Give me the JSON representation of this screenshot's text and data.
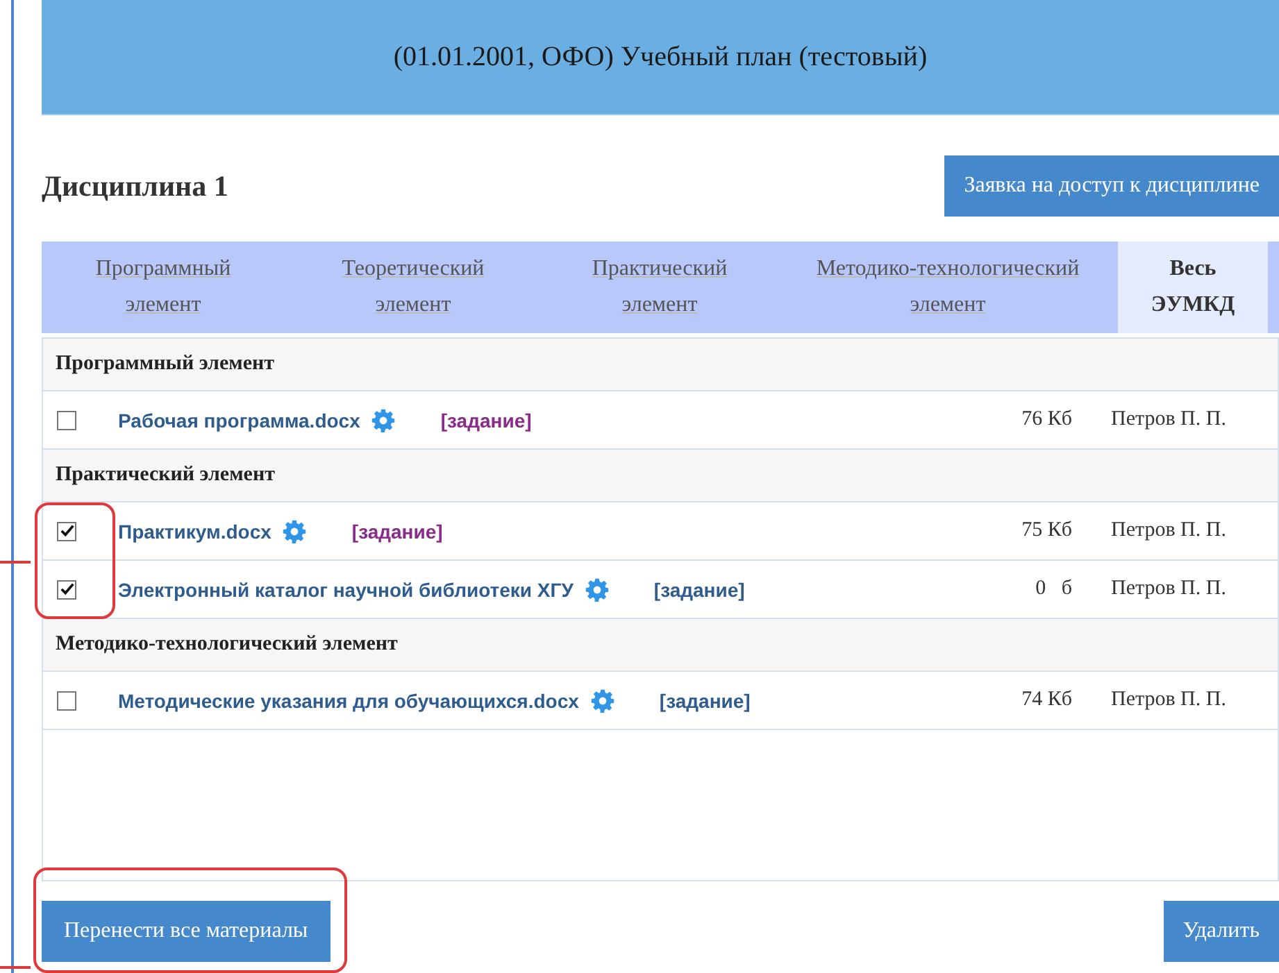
{
  "header": {
    "title": "(01.01.2001, ОФО) Учебный план (тестовый)"
  },
  "discipline": {
    "title": "Дисциплина 1",
    "request_button": "Заявка на доступ к дисциплине"
  },
  "tabs": [
    {
      "label": "Программный элемент",
      "selected": false
    },
    {
      "label": "Теоретический элемент",
      "selected": false
    },
    {
      "label": "Практический элемент",
      "selected": false
    },
    {
      "label": "Методико-технологический элемент",
      "selected": false
    },
    {
      "label": "Весь ЭУМКД",
      "selected": true
    }
  ],
  "groups": [
    {
      "title": "Программный элемент",
      "items": [
        {
          "name": "Рабочая программа.docx",
          "task": "[задание]",
          "visited": true,
          "size": "76 Кб",
          "author": "Петров П. П.",
          "checked": false,
          "highlighted": false
        }
      ]
    },
    {
      "title": "Практический элемент",
      "items": [
        {
          "name": "Практикум.docx",
          "task": "[задание]",
          "visited": true,
          "size": "75 Кб",
          "author": "Петров П. П.",
          "checked": true,
          "highlighted": true
        },
        {
          "name": "Электронный каталог научной библиотеки ХГУ",
          "task": "[задание]",
          "visited": false,
          "size": "0   б",
          "author": "Петров П. П.",
          "checked": true,
          "highlighted": true
        }
      ]
    },
    {
      "title": "Методико-технологический элемент",
      "items": [
        {
          "name": "Методические указания для обучающихся.docx",
          "task": "[задание]",
          "visited": false,
          "size": "74 Кб",
          "author": "Петров П. П.",
          "checked": false,
          "highlighted": false
        }
      ]
    }
  ],
  "actions": {
    "move_button": "Перенести все материалы",
    "delete_button": "Удалить"
  }
}
